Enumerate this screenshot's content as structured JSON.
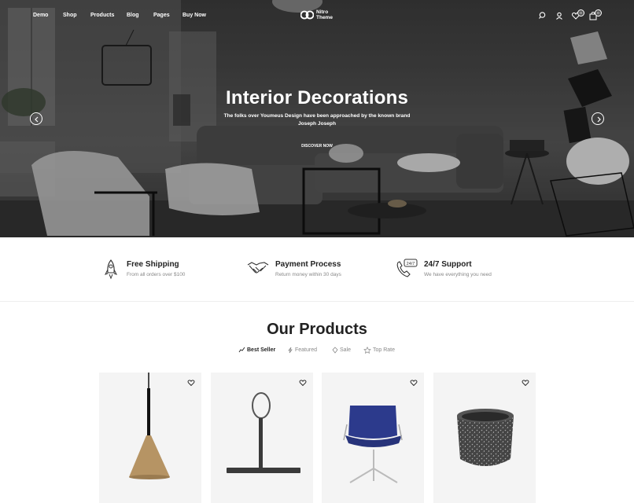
{
  "nav": {
    "items": [
      "Demo",
      "Shop",
      "Products",
      "Blog",
      "Pages",
      "Buy Now"
    ],
    "logo_text": "Nitro Theme",
    "wishlist_count": "0",
    "cart_count": "0",
    "icons": [
      "search-icon",
      "user-icon",
      "heart-icon",
      "cart-icon"
    ]
  },
  "hero": {
    "title": "Interior Decorations",
    "subtitle": "The folks over Youmeus Design have been approached by the known brand Joseph Joseph",
    "button": "DISCOVER NOW"
  },
  "features": [
    {
      "title": "Free Shipping",
      "subtitle": "From all orders over $100",
      "icon": "rocket-icon"
    },
    {
      "title": "Payment Process",
      "subtitle": "Return money within 30 days",
      "icon": "handshake-icon"
    },
    {
      "title": "24/7 Support",
      "subtitle": "We have everything you need",
      "icon": "support-phone-icon"
    }
  ],
  "products": {
    "title": "Our Products",
    "tabs": [
      {
        "label": "Best Seller",
        "icon": "chart-icon",
        "active": true
      },
      {
        "label": "Featured",
        "icon": "bolt-icon",
        "active": false
      },
      {
        "label": "Sale",
        "icon": "tag-icon",
        "active": false
      },
      {
        "label": "Top Rate",
        "icon": "star-icon",
        "active": false
      }
    ],
    "items": [
      {
        "image": "pendant-lamp"
      },
      {
        "image": "squeegee-hook"
      },
      {
        "image": "blue-office-chair"
      },
      {
        "image": "terrazzo-pot"
      }
    ]
  },
  "colors": {
    "accent": "#222222",
    "muted": "#888888",
    "card_bg": "#f4f4f4"
  }
}
